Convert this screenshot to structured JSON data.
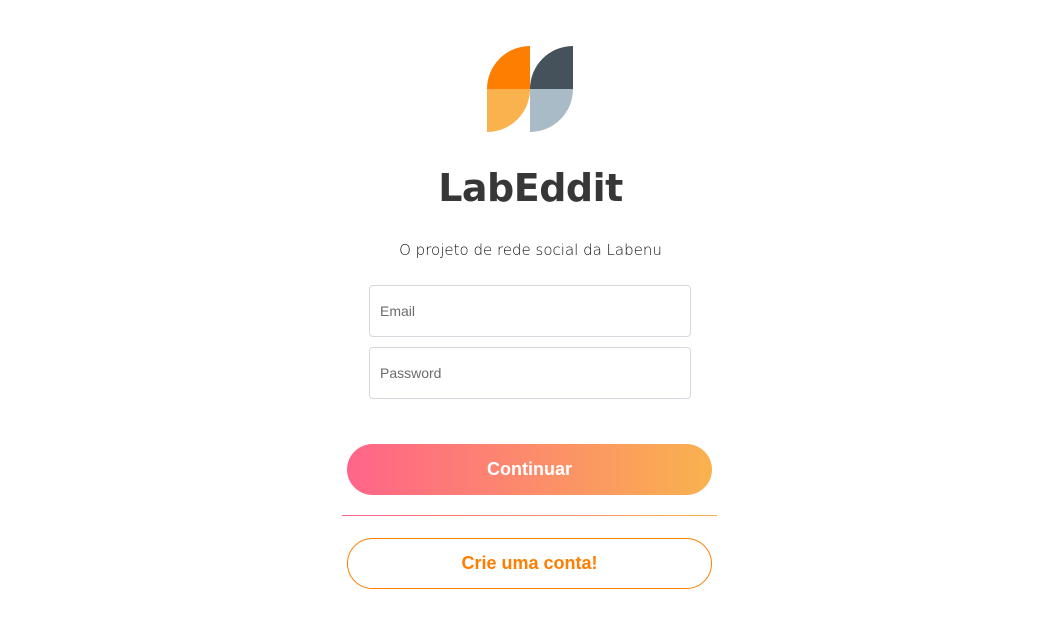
{
  "brand": {
    "logo_icon": "labeddit-logo-icon",
    "title": "LabEddit",
    "subtitle": "O projeto de rede social da Labenu"
  },
  "login_form": {
    "email_placeholder": "Email",
    "password_placeholder": "Password",
    "email_value": "",
    "password_value": ""
  },
  "actions": {
    "continue_label": "Continuar",
    "signup_label": "Crie uma conta!"
  },
  "colors": {
    "logo_orange": "#FE7E02",
    "logo_light_orange": "#F9B24E",
    "logo_dark": "#45525B",
    "logo_light_gray": "#A8BBC6",
    "title_text": "#373737",
    "gradient_start": "#FF6489",
    "gradient_end": "#F9B24E",
    "signup_accent": "#FE7E02"
  }
}
